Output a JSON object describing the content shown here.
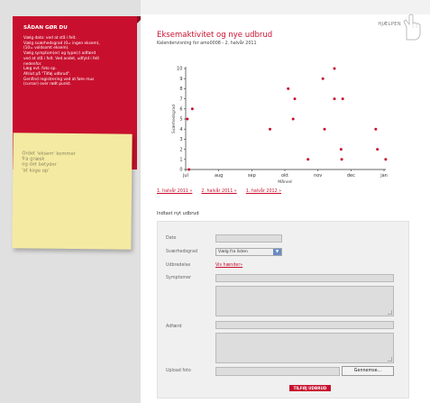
{
  "howto": {
    "title": "SÅDAN GØR DU",
    "lines": [
      "Vælg dato: ved at stå i felt.",
      "Vælg sværhedsgrad (0= ingen eksem),",
      "(10= voldsomt eksem).",
      "Vælg symptom(er) og type(r) adfærd",
      "ved at stå i felt. Ved andet, udfyld i felt",
      "nedenfor.",
      "Læg evt. foto op.",
      "Afslut på \"Tilføj udbrud\".",
      "Genfind registrering ved at føre mus",
      "(cursor) over rødt punkt."
    ]
  },
  "note": {
    "text": "Ordet 'eksem' kommer\nfra græsk\nog det betyder\n'at koge op'"
  },
  "header": {
    "help_label": "HJÆLPEN",
    "title": "Eksemaktivitet og nye udbrud",
    "subtitle": "Kalendervisning for amo0008 - 2. halvår 2011"
  },
  "chart_data": {
    "type": "scatter",
    "xlabel": "Måned",
    "ylabel": "Sværhedsgrad",
    "ylim": [
      0,
      10
    ],
    "yticks": [
      0,
      1,
      2,
      3,
      4,
      5,
      6,
      7,
      8,
      9,
      10
    ],
    "x_categories": [
      "jul",
      "aug",
      "sep",
      "okt",
      "nov",
      "dec",
      "jan"
    ],
    "grid": false,
    "color": "#c8102e",
    "points": [
      {
        "x": 0.05,
        "y": 5
      },
      {
        "x": 0.1,
        "y": 0
      },
      {
        "x": 0.2,
        "y": 6
      },
      {
        "x": 2.55,
        "y": 4
      },
      {
        "x": 3.1,
        "y": 8
      },
      {
        "x": 3.3,
        "y": 7
      },
      {
        "x": 3.25,
        "y": 5
      },
      {
        "x": 3.7,
        "y": 1
      },
      {
        "x": 4.15,
        "y": 9
      },
      {
        "x": 4.2,
        "y": 4
      },
      {
        "x": 4.5,
        "y": 10
      },
      {
        "x": 4.5,
        "y": 7
      },
      {
        "x": 4.75,
        "y": 7
      },
      {
        "x": 4.7,
        "y": 2
      },
      {
        "x": 4.72,
        "y": 1
      },
      {
        "x": 5.75,
        "y": 4
      },
      {
        "x": 5.8,
        "y": 2
      },
      {
        "x": 6.05,
        "y": 1
      }
    ]
  },
  "nav": {
    "links": [
      "1. halvår 2011 »",
      "2. halvår 2011 »",
      "1. halvår 2012 »"
    ]
  },
  "form": {
    "heading": "Indtast nyt udbrud",
    "date_label": "Dato",
    "severity_label": "Sværhedsgrad",
    "severity_value": "Vælg fra listen",
    "trigger_label": "Udbredelse",
    "trigger_link": "Vis hænder»",
    "symptoms_label": "Symptomer",
    "behavior_label": "Adfærd",
    "upload_label": "Upload foto",
    "browse_label": "Gennemse...",
    "submit_label": "TILFØJ UDBRUD"
  }
}
